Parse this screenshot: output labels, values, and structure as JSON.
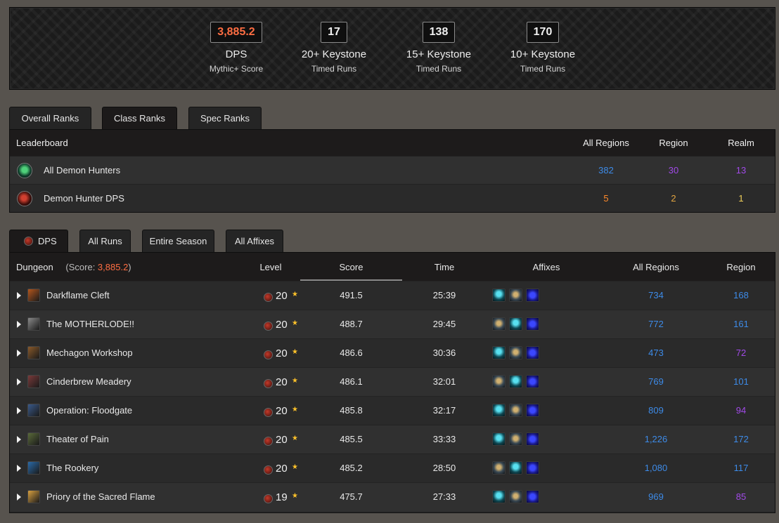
{
  "stats": [
    {
      "value": "3,885.2",
      "main": "DPS",
      "sub": "Mythic+ Score",
      "accent": true
    },
    {
      "value": "17",
      "main": "20+ Keystone",
      "sub": "Timed Runs",
      "accent": false
    },
    {
      "value": "138",
      "main": "15+ Keystone",
      "sub": "Timed Runs",
      "accent": false
    },
    {
      "value": "170",
      "main": "10+ Keystone",
      "sub": "Timed Runs",
      "accent": false
    }
  ],
  "rank_tabs": [
    "Overall Ranks",
    "Class Ranks",
    "Spec Ranks"
  ],
  "rank_tab_active": "Class Ranks",
  "ranks": {
    "headers": {
      "leaderboard": "Leaderboard",
      "all_regions": "All Regions",
      "region": "Region",
      "realm": "Realm"
    },
    "rows": [
      {
        "name": "All Demon Hunters",
        "icon": "demon-hunter-class-icon",
        "all_regions": "382",
        "region": "30",
        "realm": "13"
      },
      {
        "name": "Demon Hunter DPS",
        "icon": "havoc-spec-icon",
        "all_regions": "5",
        "region": "2",
        "realm": "1"
      }
    ]
  },
  "run_tabs": [
    "DPS",
    "All Runs",
    "Entire Season",
    "All Affixes"
  ],
  "run_tab_active": "DPS",
  "runs": {
    "headers": {
      "dungeon": "Dungeon",
      "score_prefix": "(Score: ",
      "score_value": "3,885.2",
      "score_suffix": ")",
      "level": "Level",
      "score": "Score",
      "time": "Time",
      "affixes": "Affixes",
      "all_regions": "All Regions",
      "region": "Region"
    },
    "rows": [
      {
        "dungeon": "Darkflame Cleft",
        "level": "20",
        "score": "491.5",
        "time": "25:39",
        "all_regions": "734",
        "region": "168",
        "icon_color": "#b4561d",
        "affixes": [
          "a",
          "b",
          "c"
        ]
      },
      {
        "dungeon": "The MOTHERLODE!!",
        "level": "20",
        "score": "488.7",
        "time": "29:45",
        "all_regions": "772",
        "region": "161",
        "icon_color": "#8a8a8a",
        "affixes": [
          "b",
          "a",
          "c"
        ]
      },
      {
        "dungeon": "Mechagon Workshop",
        "level": "20",
        "score": "486.6",
        "time": "30:36",
        "all_regions": "473",
        "region": "72",
        "icon_color": "#8a5a2a",
        "affixes": [
          "a",
          "b",
          "c"
        ]
      },
      {
        "dungeon": "Cinderbrew Meadery",
        "level": "20",
        "score": "486.1",
        "time": "32:01",
        "all_regions": "769",
        "region": "101",
        "icon_color": "#7a3a3a",
        "affixes": [
          "b",
          "a",
          "c"
        ]
      },
      {
        "dungeon": "Operation: Floodgate",
        "level": "20",
        "score": "485.8",
        "time": "32:17",
        "all_regions": "809",
        "region": "94",
        "icon_color": "#3a5a8a",
        "affixes": [
          "a",
          "b",
          "c"
        ]
      },
      {
        "dungeon": "Theater of Pain",
        "level": "20",
        "score": "485.5",
        "time": "33:33",
        "all_regions": "1,226",
        "region": "172",
        "icon_color": "#5a6a3a",
        "affixes": [
          "a",
          "b",
          "c"
        ]
      },
      {
        "dungeon": "The Rookery",
        "level": "20",
        "score": "485.2",
        "time": "28:50",
        "all_regions": "1,080",
        "region": "117",
        "icon_color": "#2a6aa8",
        "affixes": [
          "b",
          "a",
          "c"
        ]
      },
      {
        "dungeon": "Priory of the Sacred Flame",
        "level": "19",
        "score": "475.7",
        "time": "27:33",
        "all_regions": "969",
        "region": "85",
        "icon_color": "#d8a040",
        "affixes": [
          "a",
          "b",
          "c"
        ]
      }
    ]
  }
}
